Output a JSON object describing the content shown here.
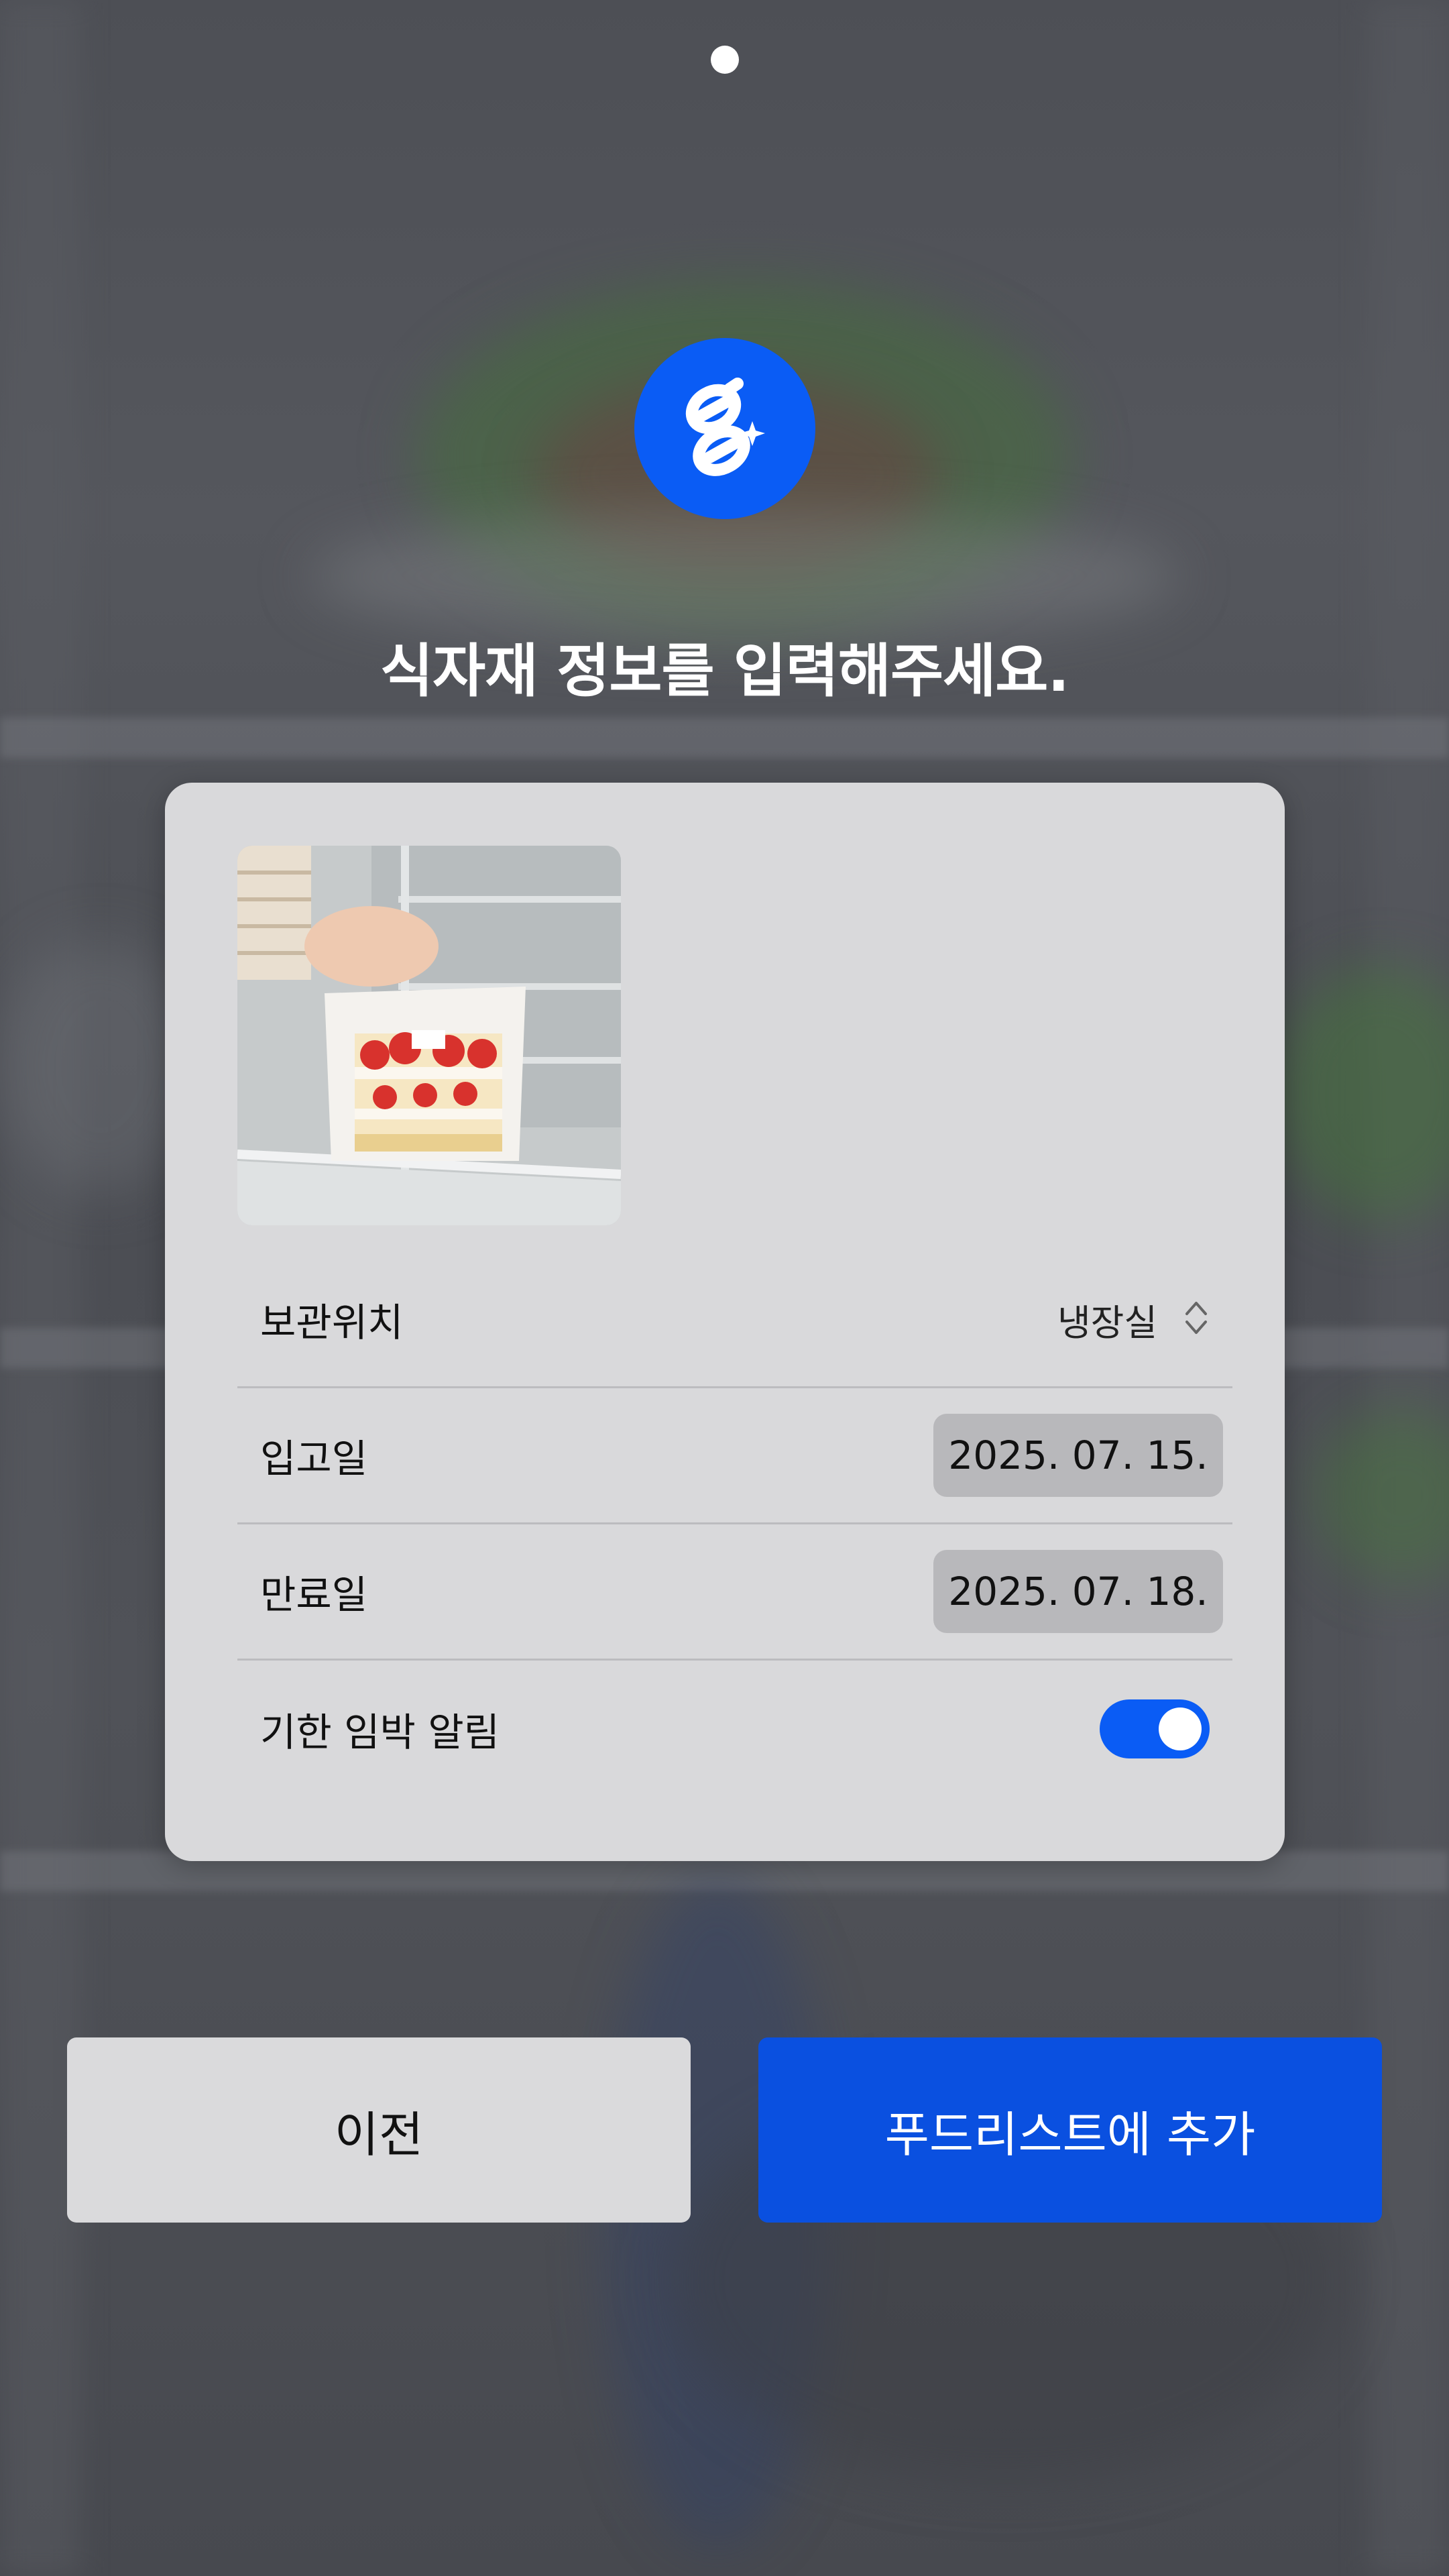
{
  "heading": "식자재 정보를 입력해주세요.",
  "form": {
    "storage": {
      "label": "보관위치",
      "value": "냉장실"
    },
    "stock_date": {
      "label": "입고일",
      "value": "2025. 07. 15."
    },
    "expiry_date": {
      "label": "만료일",
      "value": "2025. 07. 18."
    },
    "expiry_alert": {
      "label": "기한 임박 알림",
      "enabled": true
    }
  },
  "buttons": {
    "prev": "이전",
    "add": "푸드리스트에 추가"
  },
  "colors": {
    "accent": "#0a5cf5",
    "card": "#d9d9db",
    "button_secondary": "#dadadc"
  },
  "icons": {
    "logo": "app-logo-icon",
    "stepper": "chevron-up-down-icon"
  }
}
